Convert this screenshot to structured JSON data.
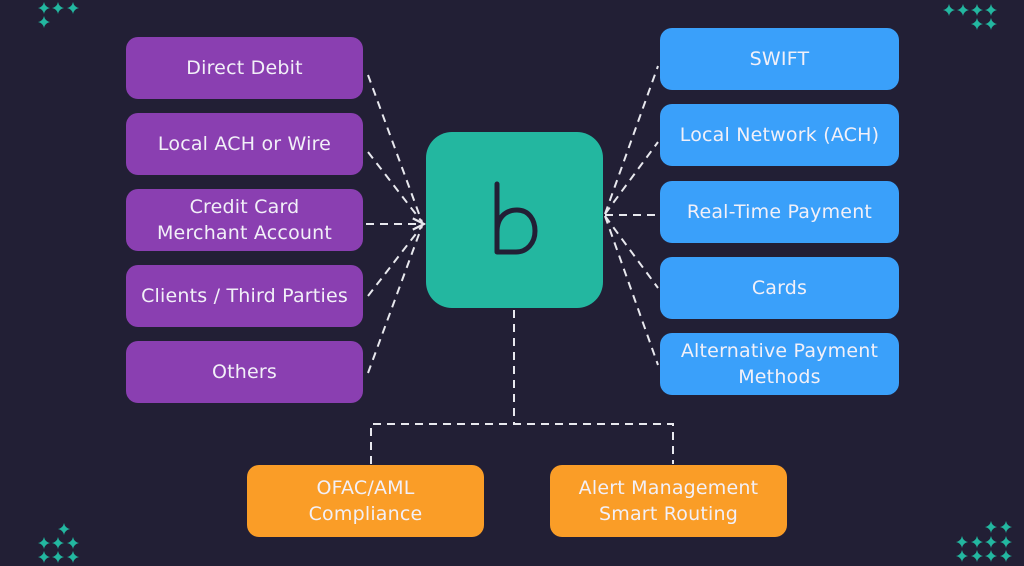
{
  "diagram": {
    "center": {
      "label": "b",
      "icon": "brand-logo-b"
    },
    "sources": [
      {
        "label": "Direct Debit"
      },
      {
        "label": "Local ACH or Wire"
      },
      {
        "label": "Credit Card\nMerchant Account"
      },
      {
        "label": "Clients / Third Parties"
      },
      {
        "label": "Others"
      }
    ],
    "destinations": [
      {
        "label": "SWIFT"
      },
      {
        "label": "Local Network (ACH)"
      },
      {
        "label": "Real-Time Payment"
      },
      {
        "label": "Cards"
      },
      {
        "label": "Alternative Payment\nMethods"
      }
    ],
    "services": [
      {
        "label": "OFAC/AML\nCompliance"
      },
      {
        "label": "Alert Management\nSmart Routing"
      }
    ],
    "colors": {
      "background": "#221f35",
      "center": "#23b7a0",
      "sources": "#8a3fb1",
      "destinations": "#3aa0fa",
      "services": "#fa9d27",
      "sparkle": "#23b7a0",
      "connector": "#e8e8ee"
    }
  }
}
